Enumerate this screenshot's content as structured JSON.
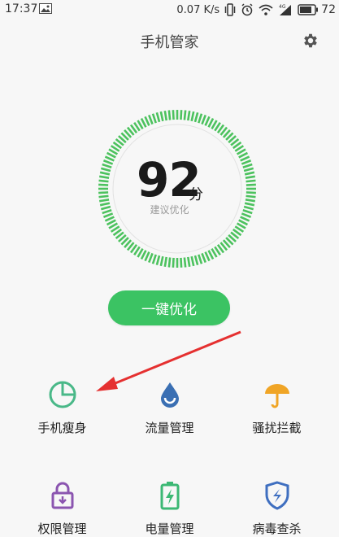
{
  "status_bar": {
    "time": "17:37",
    "network_speed": "0.07 K/s",
    "battery_level": "72",
    "icons": [
      "image-icon",
      "vibrate-icon",
      "alarm-icon",
      "wifi-icon",
      "signal-icon",
      "battery-icon"
    ]
  },
  "header": {
    "title": "手机管家",
    "settings_icon": "gear-icon"
  },
  "score": {
    "value": "92",
    "unit": "分",
    "subtitle": "建议优化",
    "ring_color": "#4cc25e"
  },
  "optimize_button": {
    "label": "一键优化",
    "color": "#3bc363"
  },
  "features": [
    {
      "label": "手机瘦身",
      "icon": "pie-chart-icon",
      "color": "#49b888"
    },
    {
      "label": "流量管理",
      "icon": "water-drop-icon",
      "color": "#3a6fb3"
    },
    {
      "label": "骚扰拦截",
      "icon": "umbrella-icon",
      "color": "#f0a526"
    },
    {
      "label": "权限管理",
      "icon": "lock-icon",
      "color": "#8b55b0"
    },
    {
      "label": "电量管理",
      "icon": "battery-charge-icon",
      "color": "#3cb874"
    },
    {
      "label": "病毒查杀",
      "icon": "shield-icon",
      "color": "#3f6fc0"
    }
  ]
}
